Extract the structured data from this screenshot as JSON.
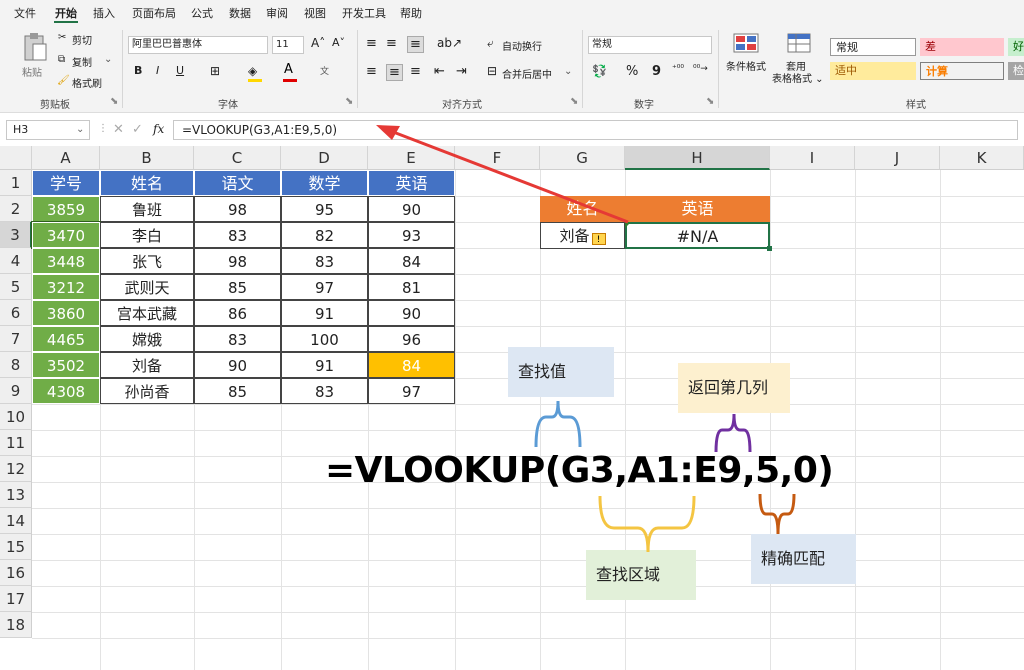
{
  "menu": {
    "tabs": [
      "文件",
      "开始",
      "插入",
      "页面布局",
      "公式",
      "数据",
      "审阅",
      "视图",
      "开发工具",
      "帮助"
    ],
    "active": "开始"
  },
  "ribbon": {
    "clipboard": {
      "paste": "粘贴",
      "cut": "剪切",
      "copy": "复制",
      "format_painter": "格式刷",
      "group": "剪贴板"
    },
    "font": {
      "name": "阿里巴巴普惠体",
      "size": "11",
      "bold": "B",
      "italic": "I",
      "underline": "U",
      "group": "字体"
    },
    "align": {
      "wrap": "自动换行",
      "merge": "合并后居中",
      "group": "对齐方式"
    },
    "number": {
      "format": "常规",
      "percent": "%",
      "comma": "9",
      "group": "数字"
    },
    "styles": {
      "conditional": "条件格式",
      "table_style": "套用\n表格格式",
      "group": "样式",
      "cells": [
        {
          "label": "常规",
          "bg": "#ffffff",
          "fg": "#000000"
        },
        {
          "label": "差",
          "bg": "#ffc7ce",
          "fg": "#9c0006"
        },
        {
          "label": "好",
          "bg": "#c6efce",
          "fg": "#006100"
        },
        {
          "label": "适中",
          "bg": "#ffeb9c",
          "fg": "#9c5700"
        },
        {
          "label": "计算",
          "bg": "#f2f2f2",
          "fg": "#fa7d00"
        },
        {
          "label": "检",
          "bg": "#a5a5a5",
          "fg": "#ffffff"
        }
      ]
    }
  },
  "formula_bar": {
    "cell_ref": "H3",
    "fx": "fx",
    "formula": "=VLOOKUP(G3,A1:E9,5,0)"
  },
  "columns": [
    "A",
    "B",
    "C",
    "D",
    "E",
    "F",
    "G",
    "H",
    "I",
    "J",
    "K"
  ],
  "rows": [
    "1",
    "2",
    "3",
    "4",
    "5",
    "6",
    "7",
    "8",
    "9",
    "10",
    "11",
    "12",
    "13",
    "14",
    "15",
    "16",
    "17",
    "18"
  ],
  "table": {
    "headers": [
      "学号",
      "姓名",
      "语文",
      "数学",
      "英语"
    ],
    "rows": [
      [
        "3859",
        "鲁班",
        "98",
        "95",
        "90"
      ],
      [
        "3470",
        "李白",
        "83",
        "82",
        "93"
      ],
      [
        "3448",
        "张飞",
        "98",
        "83",
        "84"
      ],
      [
        "3212",
        "武则天",
        "85",
        "97",
        "81"
      ],
      [
        "3860",
        "宫本武藏",
        "86",
        "91",
        "90"
      ],
      [
        "4465",
        "嫦娥",
        "83",
        "100",
        "96"
      ],
      [
        "3502",
        "刘备",
        "90",
        "91",
        "84"
      ],
      [
        "4308",
        "孙尚香",
        "85",
        "83",
        "97"
      ]
    ]
  },
  "lookup": {
    "headers": [
      "姓名",
      "英语"
    ],
    "name": "刘备",
    "result": "#N/A"
  },
  "annotation": {
    "formula": "=VLOOKUP(G3,A1:E9,5,0)",
    "lookup_value": "查找值",
    "col_index": "返回第几列",
    "lookup_range": "查找区域",
    "exact_match": "精确匹配"
  },
  "colors": {
    "header_blue": "#4472c4",
    "id_green": "#70ad47",
    "highlight": "#ffc000",
    "lookup_orange": "#ed7d31",
    "arrow": "#e53935"
  }
}
